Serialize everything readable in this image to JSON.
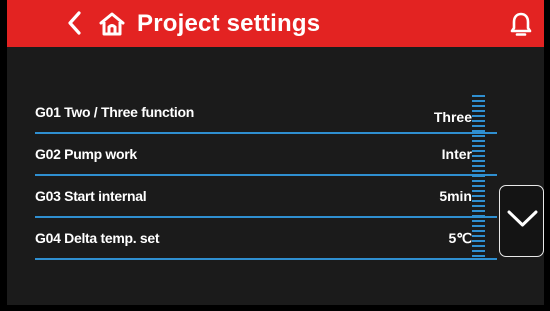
{
  "header": {
    "title": "Project settings",
    "back_icon": "chevron-left-icon",
    "home_icon": "home-icon",
    "bell_icon": "bell-icon"
  },
  "settings": [
    {
      "label": "G01 Two / Three function",
      "value": "Three"
    },
    {
      "label": "G02 Pump work",
      "value": "Inter"
    },
    {
      "label": "G03 Start internal",
      "value": "5min"
    },
    {
      "label": "G04 Delta temp. set",
      "value": "5℃"
    }
  ],
  "scroll_down_icon": "chevron-down-icon",
  "colors": {
    "header_bg": "#e32322",
    "background": "#1b1b1b",
    "divider": "#2f8fd0",
    "text": "#ffffff"
  }
}
